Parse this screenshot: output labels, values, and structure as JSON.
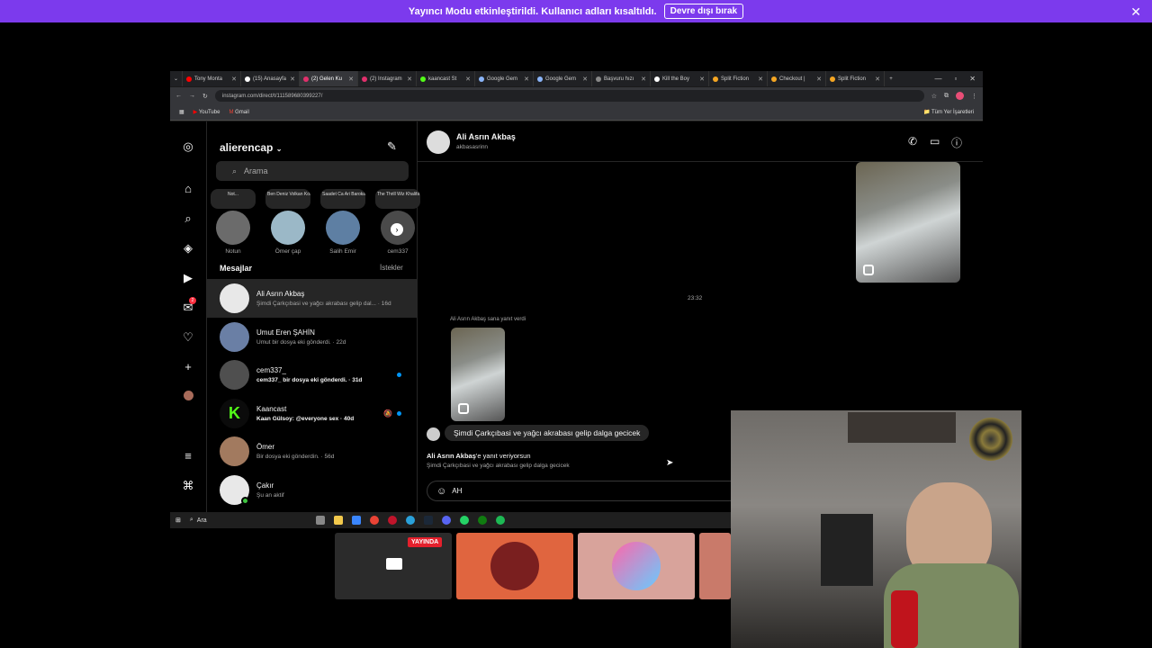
{
  "streamer_bar": {
    "message": "Yayıncı Modu etkinleştirildi. Kullanıcı adları kısaltıldı.",
    "disable_label": "Devre dışı bırak"
  },
  "browser": {
    "tabs": [
      {
        "label": "Tony Monta",
        "color": "#ff0000"
      },
      {
        "label": "(15) Anasayfa",
        "color": "#ffffff"
      },
      {
        "label": "(2) Gelen Ku",
        "color": "#e1306c",
        "active": true
      },
      {
        "label": "(2) Instagram",
        "color": "#e1306c"
      },
      {
        "label": "kaancast St",
        "color": "#53fc18"
      },
      {
        "label": "Google Gem",
        "color": "#8ab4f8"
      },
      {
        "label": "Google Gem",
        "color": "#8ab4f8"
      },
      {
        "label": "Başvuru hızı",
        "color": "#888888"
      },
      {
        "label": "Kill the Boy",
        "color": "#ffffff"
      },
      {
        "label": "Split Fiction",
        "color": "#f5a623"
      },
      {
        "label": "Checkout | ",
        "color": "#f5a623"
      },
      {
        "label": "Split Fiction",
        "color": "#f5a623"
      }
    ],
    "url": "instagram.com/direct/t/111589680399227/",
    "bookmarks": [
      "YouTube",
      "Gmail"
    ],
    "all_bookmarks": "Tüm Yer İşaretleri"
  },
  "dm_list": {
    "username": "alierencap",
    "search_placeholder": "Arama",
    "stories": [
      {
        "note": "Not...",
        "name": "Notun"
      },
      {
        "note": "Ben Deniz Volkan Konak",
        "name": "Ömer çap"
      },
      {
        "note": "Saadet Ca Ari Barokan",
        "name": "Salih Emir"
      },
      {
        "note": "The Thrill Wiz Khalifa",
        "name": "cem337"
      }
    ],
    "section_title": "Mesajlar",
    "requests": "İstekler",
    "conversations": [
      {
        "name": "Ali Asrın Akbaş",
        "preview": "Şimdi Çarkçıbasi ve yağcı akrabası gelip dal... · 16d",
        "bold": false
      },
      {
        "name": "Umut Eren ŞAHİN",
        "preview": "Umut bir dosya eki gönderdi. · 22d",
        "bold": false
      },
      {
        "name": "cem337_",
        "preview": "cem337_ bir dosya eki gönderdi. · 31d",
        "bold": true
      },
      {
        "name": "Kaancast",
        "preview": "Kaan Gülsoy: @everyone sex · 40d",
        "bold": true
      },
      {
        "name": "Ömer",
        "preview": "Bir dosya eki gönderdin. · 56d",
        "bold": false
      },
      {
        "name": "Çakır",
        "preview": "Şu an aktif",
        "bold": false
      }
    ]
  },
  "chat": {
    "peer_name": "Ali Asrın Akbaş",
    "peer_username": "akbasasrinn",
    "timestamp": "23:32",
    "replied_label": "Ali Asrın Akbaş sana yanıt verdi",
    "message": "Şimdi Çarkçıbasi ve yağcı akrabası gelip dalga gecicek",
    "replying_name": "Ali Asrın Akbaş",
    "replying_suffix": "'e yanıt veriyorsun",
    "replying_text": "Şimdi Çarkçıbasi ve yağcı akrabası gelip dalga gecicek",
    "composer_value": "AH"
  },
  "taskbar": {
    "search_label": "Ara"
  },
  "stream": {
    "live_label": "YAYINDA"
  },
  "colors": {
    "accent": "#7c3aed",
    "ig_blue": "#0095f6",
    "live_red": "#e4202c"
  }
}
